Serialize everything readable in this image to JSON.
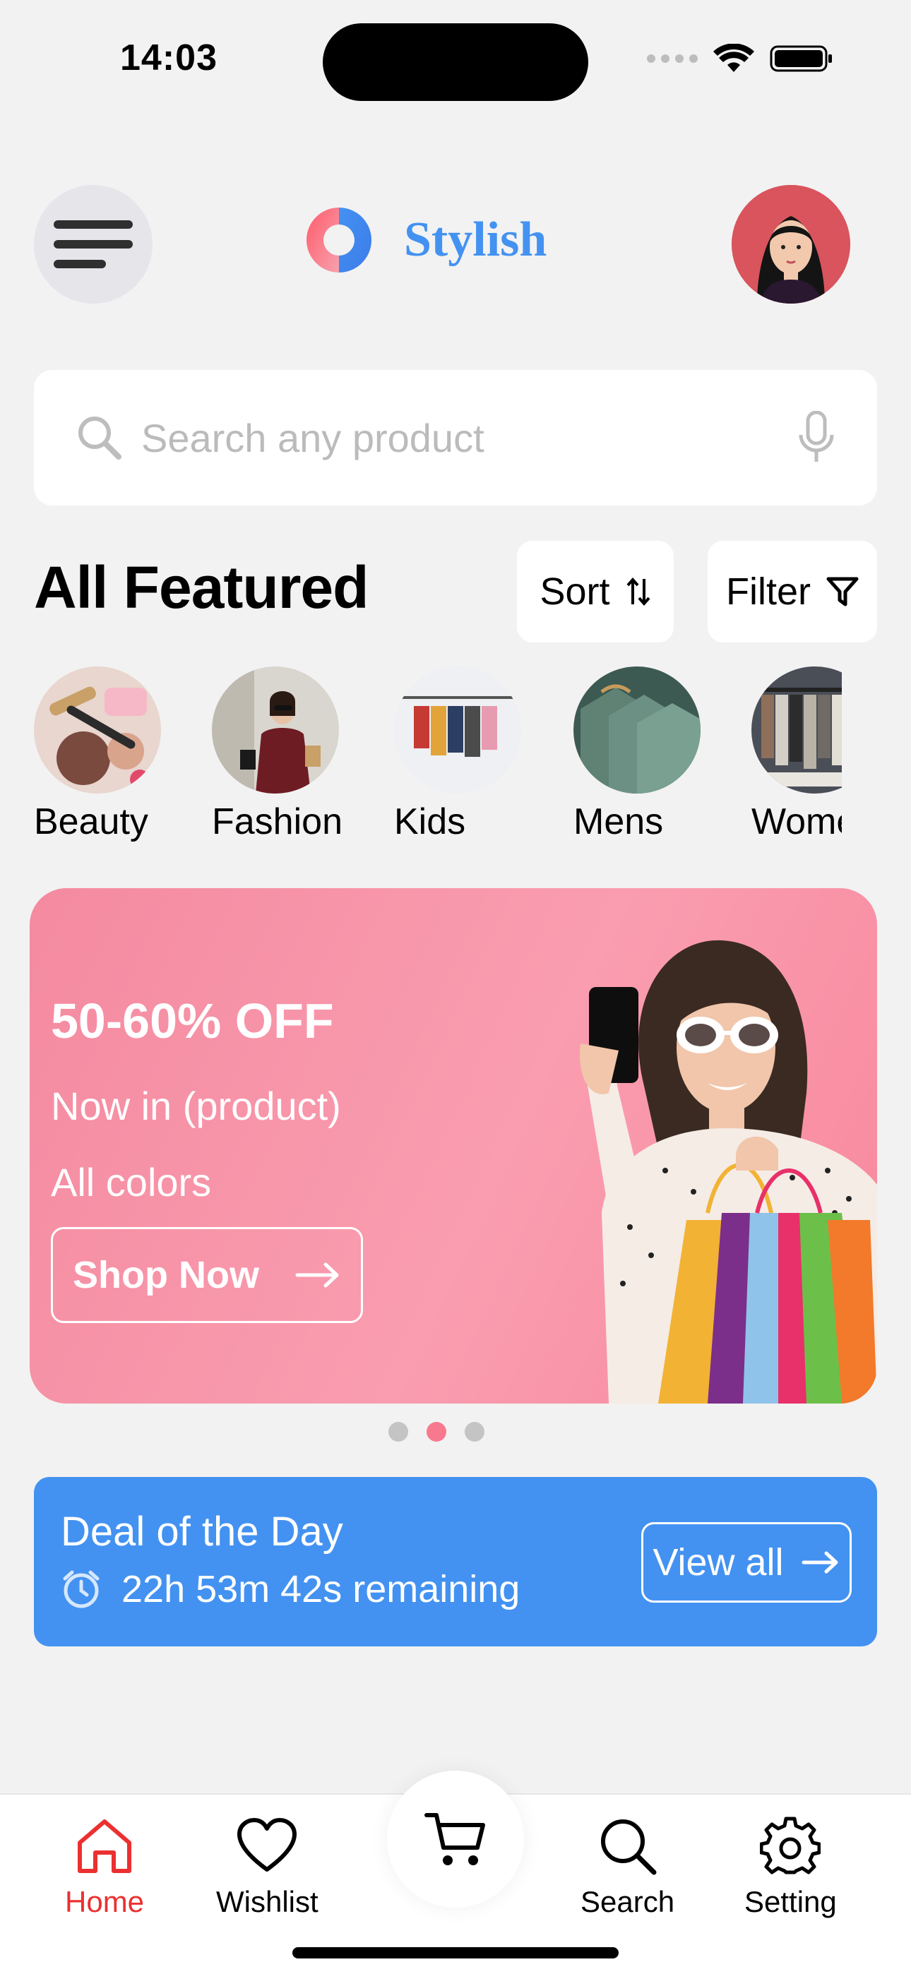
{
  "status_bar": {
    "time": "14:03"
  },
  "header": {
    "brand": "Stylish"
  },
  "search": {
    "placeholder": "Search any product"
  },
  "featured": {
    "title": "All Featured",
    "sort_label": "Sort",
    "filter_label": "Filter",
    "categories": [
      {
        "label": "Beauty"
      },
      {
        "label": "Fashion"
      },
      {
        "label": "Kids"
      },
      {
        "label": "Mens"
      },
      {
        "label": "Womens"
      }
    ]
  },
  "banner": {
    "title": "50-60% OFF",
    "line1": "Now in (product)",
    "line2": "All colors",
    "cta": "Shop Now",
    "active_dot": 2,
    "dot_count": 3
  },
  "deal": {
    "title": "Deal of the Day",
    "timer": "22h 53m 42s remaining",
    "cta": "View all"
  },
  "bottom_nav": {
    "items": [
      {
        "label": "Home",
        "active": true
      },
      {
        "label": "Wishlist"
      },
      {
        "label": "Search"
      },
      {
        "label": "Setting"
      }
    ]
  },
  "colors": {
    "accent_blue": "#4392f1",
    "banner_pink": "#f895a9",
    "active_red": "#eb3030",
    "dot_active": "#f8798e"
  }
}
